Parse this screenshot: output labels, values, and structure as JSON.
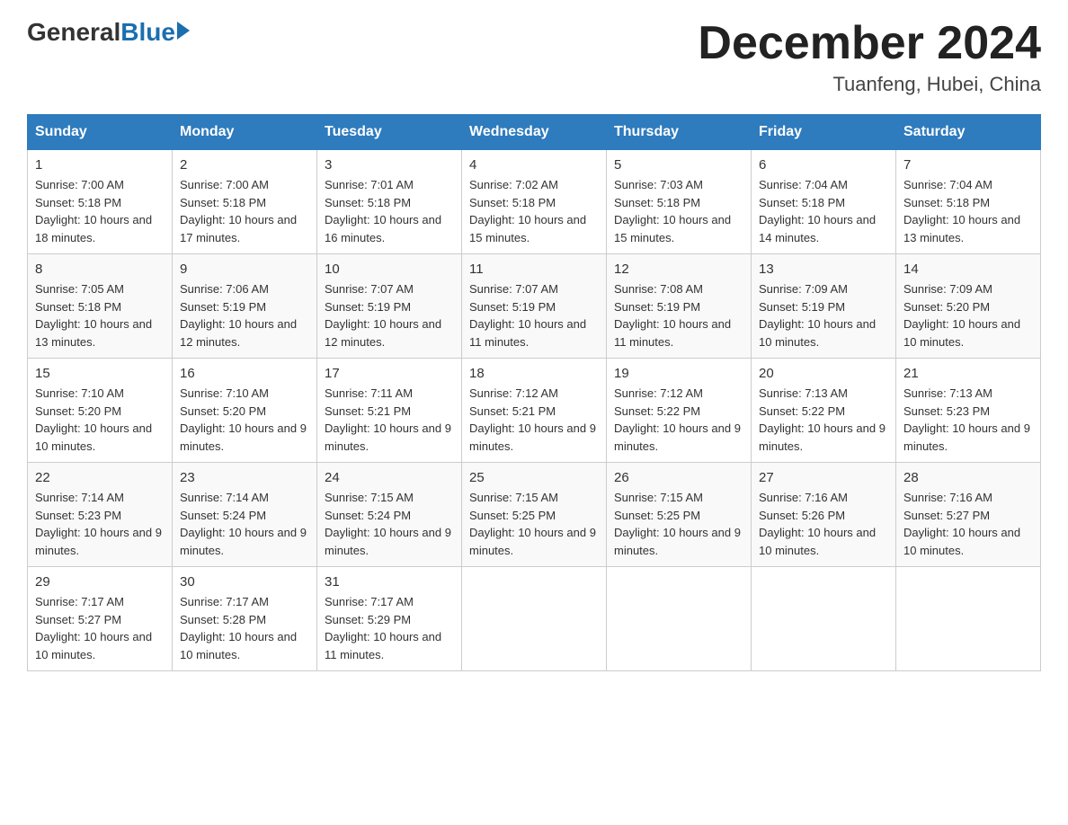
{
  "header": {
    "logo_general": "General",
    "logo_blue": "Blue",
    "month_title": "December 2024",
    "location": "Tuanfeng, Hubei, China"
  },
  "days_of_week": [
    "Sunday",
    "Monday",
    "Tuesday",
    "Wednesday",
    "Thursday",
    "Friday",
    "Saturday"
  ],
  "weeks": [
    [
      {
        "day": "1",
        "sunrise": "7:00 AM",
        "sunset": "5:18 PM",
        "daylight": "10 hours and 18 minutes."
      },
      {
        "day": "2",
        "sunrise": "7:00 AM",
        "sunset": "5:18 PM",
        "daylight": "10 hours and 17 minutes."
      },
      {
        "day": "3",
        "sunrise": "7:01 AM",
        "sunset": "5:18 PM",
        "daylight": "10 hours and 16 minutes."
      },
      {
        "day": "4",
        "sunrise": "7:02 AM",
        "sunset": "5:18 PM",
        "daylight": "10 hours and 15 minutes."
      },
      {
        "day": "5",
        "sunrise": "7:03 AM",
        "sunset": "5:18 PM",
        "daylight": "10 hours and 15 minutes."
      },
      {
        "day": "6",
        "sunrise": "7:04 AM",
        "sunset": "5:18 PM",
        "daylight": "10 hours and 14 minutes."
      },
      {
        "day": "7",
        "sunrise": "7:04 AM",
        "sunset": "5:18 PM",
        "daylight": "10 hours and 13 minutes."
      }
    ],
    [
      {
        "day": "8",
        "sunrise": "7:05 AM",
        "sunset": "5:18 PM",
        "daylight": "10 hours and 13 minutes."
      },
      {
        "day": "9",
        "sunrise": "7:06 AM",
        "sunset": "5:19 PM",
        "daylight": "10 hours and 12 minutes."
      },
      {
        "day": "10",
        "sunrise": "7:07 AM",
        "sunset": "5:19 PM",
        "daylight": "10 hours and 12 minutes."
      },
      {
        "day": "11",
        "sunrise": "7:07 AM",
        "sunset": "5:19 PM",
        "daylight": "10 hours and 11 minutes."
      },
      {
        "day": "12",
        "sunrise": "7:08 AM",
        "sunset": "5:19 PM",
        "daylight": "10 hours and 11 minutes."
      },
      {
        "day": "13",
        "sunrise": "7:09 AM",
        "sunset": "5:19 PM",
        "daylight": "10 hours and 10 minutes."
      },
      {
        "day": "14",
        "sunrise": "7:09 AM",
        "sunset": "5:20 PM",
        "daylight": "10 hours and 10 minutes."
      }
    ],
    [
      {
        "day": "15",
        "sunrise": "7:10 AM",
        "sunset": "5:20 PM",
        "daylight": "10 hours and 10 minutes."
      },
      {
        "day": "16",
        "sunrise": "7:10 AM",
        "sunset": "5:20 PM",
        "daylight": "10 hours and 9 minutes."
      },
      {
        "day": "17",
        "sunrise": "7:11 AM",
        "sunset": "5:21 PM",
        "daylight": "10 hours and 9 minutes."
      },
      {
        "day": "18",
        "sunrise": "7:12 AM",
        "sunset": "5:21 PM",
        "daylight": "10 hours and 9 minutes."
      },
      {
        "day": "19",
        "sunrise": "7:12 AM",
        "sunset": "5:22 PM",
        "daylight": "10 hours and 9 minutes."
      },
      {
        "day": "20",
        "sunrise": "7:13 AM",
        "sunset": "5:22 PM",
        "daylight": "10 hours and 9 minutes."
      },
      {
        "day": "21",
        "sunrise": "7:13 AM",
        "sunset": "5:23 PM",
        "daylight": "10 hours and 9 minutes."
      }
    ],
    [
      {
        "day": "22",
        "sunrise": "7:14 AM",
        "sunset": "5:23 PM",
        "daylight": "10 hours and 9 minutes."
      },
      {
        "day": "23",
        "sunrise": "7:14 AM",
        "sunset": "5:24 PM",
        "daylight": "10 hours and 9 minutes."
      },
      {
        "day": "24",
        "sunrise": "7:15 AM",
        "sunset": "5:24 PM",
        "daylight": "10 hours and 9 minutes."
      },
      {
        "day": "25",
        "sunrise": "7:15 AM",
        "sunset": "5:25 PM",
        "daylight": "10 hours and 9 minutes."
      },
      {
        "day": "26",
        "sunrise": "7:15 AM",
        "sunset": "5:25 PM",
        "daylight": "10 hours and 9 minutes."
      },
      {
        "day": "27",
        "sunrise": "7:16 AM",
        "sunset": "5:26 PM",
        "daylight": "10 hours and 10 minutes."
      },
      {
        "day": "28",
        "sunrise": "7:16 AM",
        "sunset": "5:27 PM",
        "daylight": "10 hours and 10 minutes."
      }
    ],
    [
      {
        "day": "29",
        "sunrise": "7:17 AM",
        "sunset": "5:27 PM",
        "daylight": "10 hours and 10 minutes."
      },
      {
        "day": "30",
        "sunrise": "7:17 AM",
        "sunset": "5:28 PM",
        "daylight": "10 hours and 10 minutes."
      },
      {
        "day": "31",
        "sunrise": "7:17 AM",
        "sunset": "5:29 PM",
        "daylight": "10 hours and 11 minutes."
      },
      null,
      null,
      null,
      null
    ]
  ],
  "labels": {
    "sunrise": "Sunrise:",
    "sunset": "Sunset:",
    "daylight": "Daylight:"
  }
}
